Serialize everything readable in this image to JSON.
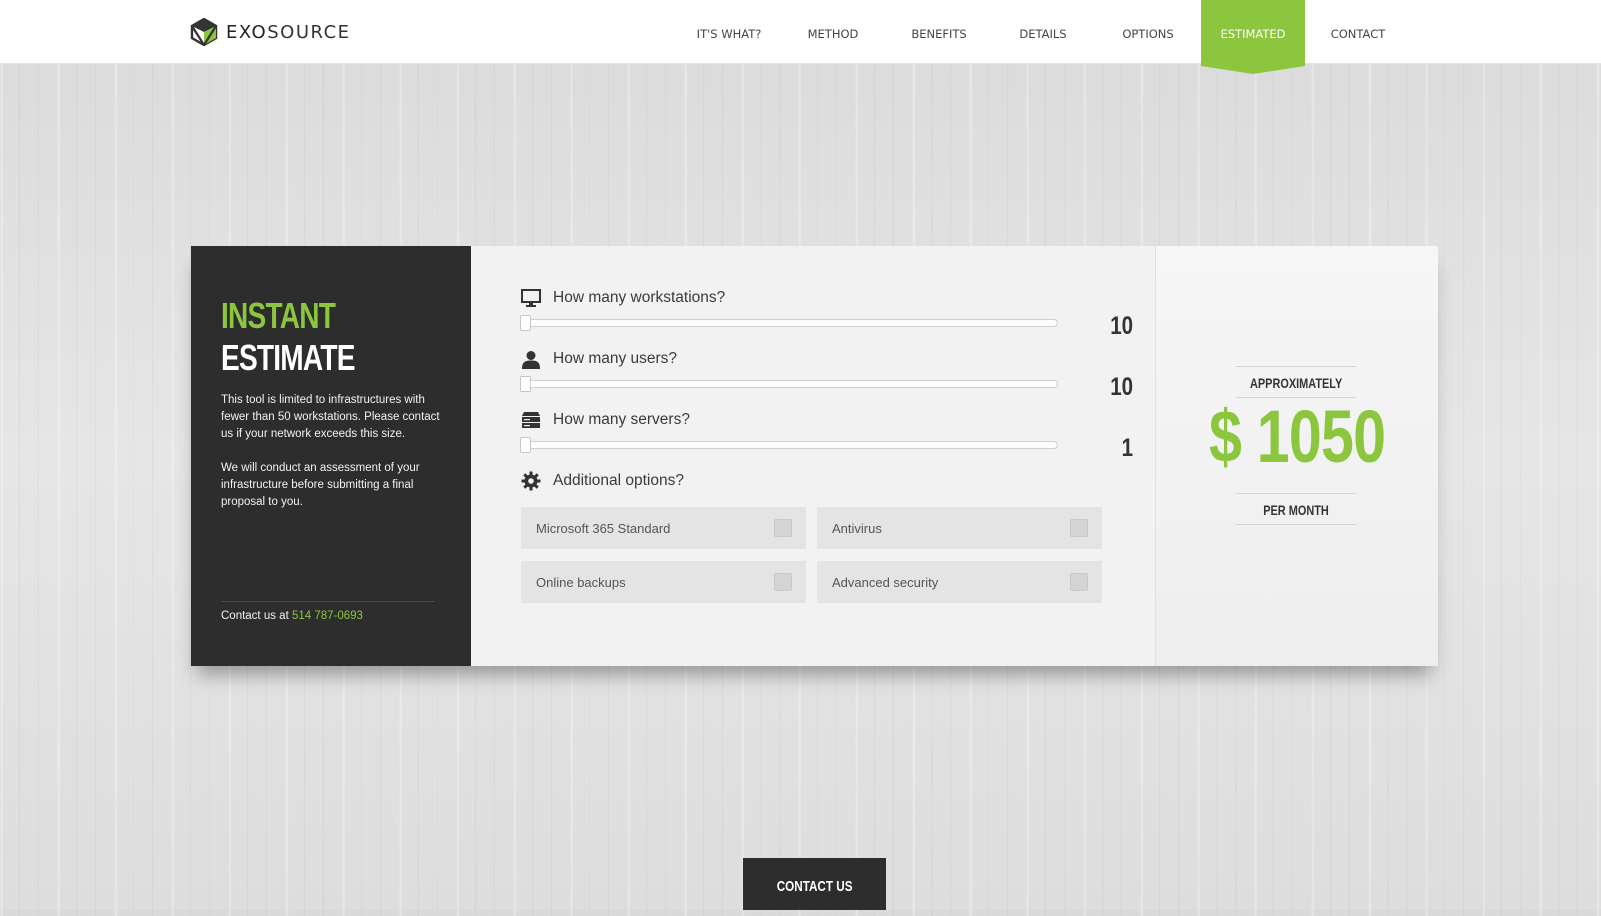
{
  "brand": {
    "logo_prefix": "EXO",
    "logo_suffix": "SOURCE",
    "accent": "#8cc63f"
  },
  "nav": {
    "items": [
      {
        "label": "IT'S WHAT?"
      },
      {
        "label": "METHOD"
      },
      {
        "label": "BENEFITS"
      },
      {
        "label": "DETAILS"
      },
      {
        "label": "OPTIONS"
      },
      {
        "label": "ESTIMATED",
        "active": true
      },
      {
        "label": "CONTACT"
      }
    ]
  },
  "estimate": {
    "title_line1": "INSTANT",
    "title_line2": "ESTIMATE",
    "desc_p1": "This tool is limited to infrastructures with fewer than 50 workstations. Please contact us if your network exceeds this size.",
    "desc_p2": "We will conduct an assessment of your infrastructure before submitting a final proposal to you.",
    "contact_prefix": "Contact us at",
    "phone": "514 787-0693"
  },
  "questions": [
    {
      "label": "How many workstations?",
      "value": "10",
      "icon": "monitor-icon"
    },
    {
      "label": "How many users?",
      "value": "10",
      "icon": "user-icon"
    },
    {
      "label": "How many servers?",
      "value": "1",
      "icon": "server-icon"
    }
  ],
  "options": {
    "label": "Additional options?",
    "icon": "gear-icon",
    "items": [
      {
        "label": "Microsoft 365 Standard",
        "checked": false
      },
      {
        "label": "Antivirus",
        "checked": false
      },
      {
        "label": "Online backups",
        "checked": false
      },
      {
        "label": "Advanced security",
        "checked": false
      }
    ]
  },
  "result": {
    "approx_label": "APPROXIMATELY",
    "currency": "$",
    "amount": "1050",
    "per_label": "PER MONTH"
  },
  "footer": {
    "contact_button": "CONTACT US"
  }
}
